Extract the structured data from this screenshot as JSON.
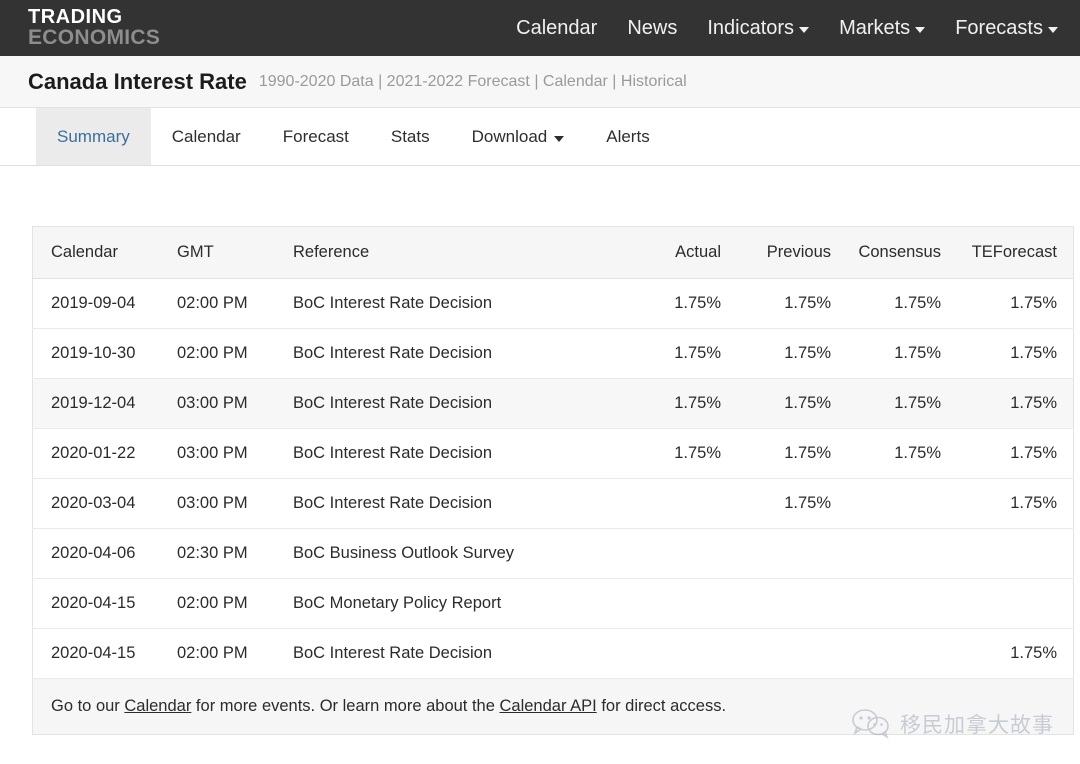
{
  "navbar": {
    "brand_line1": "TRADING",
    "brand_line2": "ECONOMICS",
    "items": [
      {
        "label": "Calendar",
        "has_caret": false
      },
      {
        "label": "News",
        "has_caret": false
      },
      {
        "label": "Indicators",
        "has_caret": true
      },
      {
        "label": "Markets",
        "has_caret": true
      },
      {
        "label": "Forecasts",
        "has_caret": true
      }
    ]
  },
  "header": {
    "title": "Canada Interest Rate",
    "subtitle": "1990-2020 Data | 2021-2022 Forecast | Calendar | Historical"
  },
  "tabs": [
    {
      "label": "Summary",
      "active": true,
      "has_caret": false
    },
    {
      "label": "Calendar",
      "active": false,
      "has_caret": false
    },
    {
      "label": "Forecast",
      "active": false,
      "has_caret": false
    },
    {
      "label": "Stats",
      "active": false,
      "has_caret": false
    },
    {
      "label": "Download",
      "active": false,
      "has_caret": true
    },
    {
      "label": "Alerts",
      "active": false,
      "has_caret": false
    }
  ],
  "table": {
    "columns": [
      "Calendar",
      "GMT",
      "Reference",
      "Actual",
      "Previous",
      "Consensus",
      "TEForecast"
    ],
    "rows": [
      {
        "date": "2019-09-04",
        "gmt": "02:00 PM",
        "reference": "BoC Interest Rate Decision",
        "actual": "1.75%",
        "previous": "1.75%",
        "consensus": "1.75%",
        "teforecast": "1.75%"
      },
      {
        "date": "2019-10-30",
        "gmt": "02:00 PM",
        "reference": "BoC Interest Rate Decision",
        "actual": "1.75%",
        "previous": "1.75%",
        "consensus": "1.75%",
        "teforecast": "1.75%"
      },
      {
        "date": "2019-12-04",
        "gmt": "03:00 PM",
        "reference": "BoC Interest Rate Decision",
        "actual": "1.75%",
        "previous": "1.75%",
        "consensus": "1.75%",
        "teforecast": "1.75%"
      },
      {
        "date": "2020-01-22",
        "gmt": "03:00 PM",
        "reference": "BoC Interest Rate Decision",
        "actual": "1.75%",
        "previous": "1.75%",
        "consensus": "1.75%",
        "teforecast": "1.75%"
      },
      {
        "date": "2020-03-04",
        "gmt": "03:00 PM",
        "reference": "BoC Interest Rate Decision",
        "actual": "",
        "previous": "1.75%",
        "consensus": "",
        "teforecast": "1.75%"
      },
      {
        "date": "2020-04-06",
        "gmt": "02:30 PM",
        "reference": "BoC Business Outlook Survey",
        "actual": "",
        "previous": "",
        "consensus": "",
        "teforecast": ""
      },
      {
        "date": "2020-04-15",
        "gmt": "02:00 PM",
        "reference": "BoC Monetary Policy Report",
        "actual": "",
        "previous": "",
        "consensus": "",
        "teforecast": ""
      },
      {
        "date": "2020-04-15",
        "gmt": "02:00 PM",
        "reference": "BoC Interest Rate Decision",
        "actual": "",
        "previous": "",
        "consensus": "",
        "teforecast": "1.75%"
      }
    ],
    "footer": {
      "text_part1": "Go to our ",
      "link1": "Calendar",
      "text_part2": " for more events. Or learn more about the ",
      "link2": "Calendar API",
      "text_part3": " for direct access."
    }
  },
  "watermark": {
    "text": "移民加拿大故事",
    "icon": "wechat-icon"
  },
  "colors": {
    "navbar_bg": "#333333",
    "active_tab_text": "#3a6f9a",
    "active_tab_bg": "#ebebeb",
    "header_bg": "#f7f7f7",
    "table_header_bg": "#f6f6f6"
  }
}
